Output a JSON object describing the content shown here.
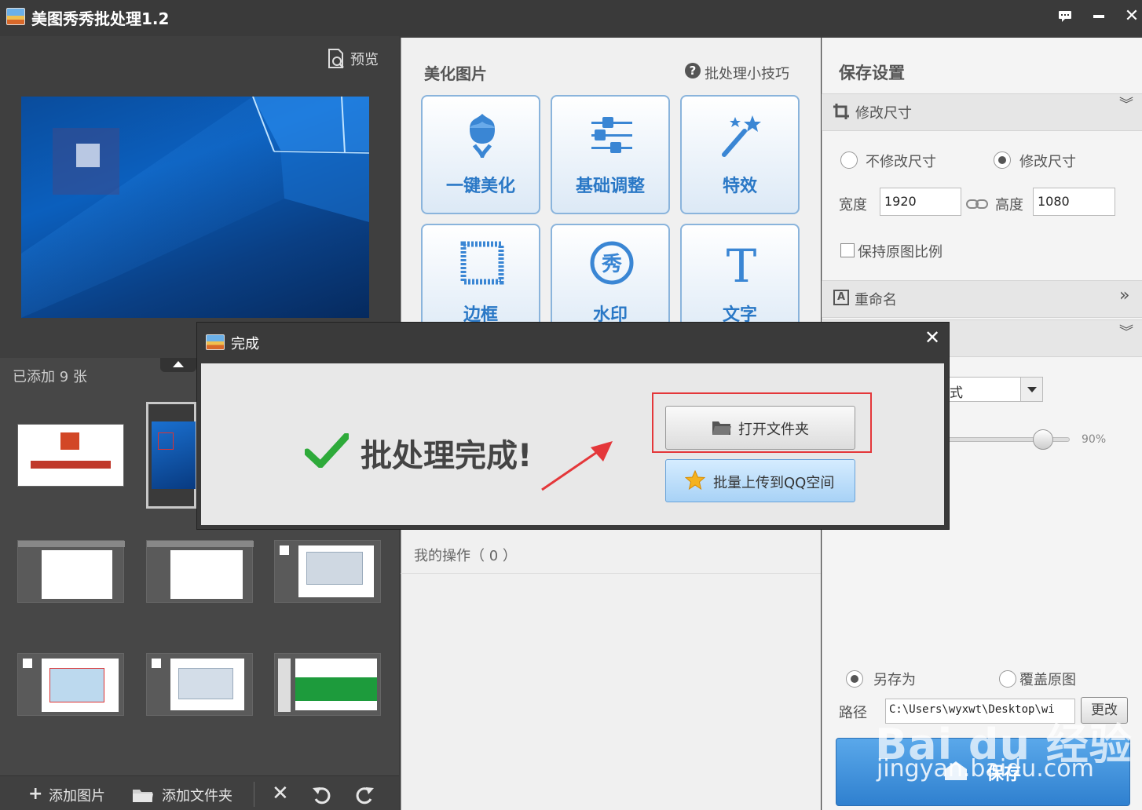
{
  "titlebar": {
    "title": "美图秀秀批处理1.2"
  },
  "left": {
    "preview_label": "预览",
    "added_count": "已添加 9 张",
    "toolbar": {
      "add_image": "添加图片",
      "add_folder": "添加文件夹"
    }
  },
  "middle": {
    "title": "美化图片",
    "tips": "批处理小技巧",
    "tools": [
      {
        "label": "一键美化",
        "icon": "tulip-icon"
      },
      {
        "label": "基础调整",
        "icon": "sliders-icon"
      },
      {
        "label": "特效",
        "icon": "magic-wand-icon"
      },
      {
        "label": "边框",
        "icon": "frame-icon"
      },
      {
        "label": "水印",
        "icon": "watermark-xiu-icon"
      },
      {
        "label": "文字",
        "icon": "text-t-icon"
      }
    ],
    "my_operations": "我的操作（ 0 ）"
  },
  "right": {
    "title": "保存设置",
    "resize": {
      "header": "修改尺寸",
      "opt_keep": "不修改尺寸",
      "opt_change": "修改尺寸",
      "selected": "修改尺寸",
      "width_label": "宽度",
      "width_value": "1920",
      "height_label": "高度",
      "height_value": "1080",
      "keep_ratio": "保持原图比例"
    },
    "rename": {
      "header": "重命名"
    },
    "format": {
      "select_value_partial": "式",
      "quality": "90%"
    },
    "save_mode": {
      "save_as": "另存为",
      "overwrite": "覆盖原图",
      "selected": "另存为"
    },
    "path": {
      "label": "路径",
      "value": "C:\\Users\\wyxwt\\Desktop\\wi",
      "change_button": "更改"
    },
    "save_button": "保存"
  },
  "dialog": {
    "title": "完成",
    "message": "批处理完成!",
    "open_folder": "打开文件夹",
    "upload_qq": "批量上传到QQ空间"
  },
  "watermark": {
    "brand": "Bai du 经验",
    "url": "jingyan.baidu.com"
  },
  "colors": {
    "accent": "#2a78c6",
    "highlight": "#e4373a",
    "check": "#2eaa3a"
  }
}
